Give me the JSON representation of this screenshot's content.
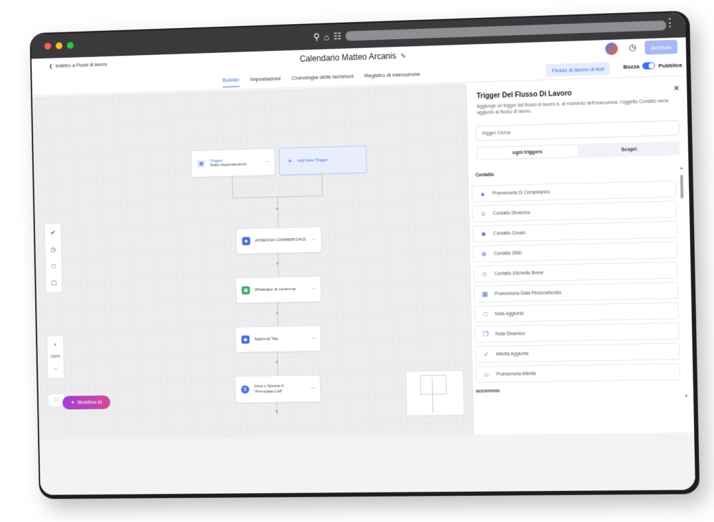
{
  "browser": {
    "url_placeholder": ""
  },
  "header": {
    "back_label": "Indietro a Flussi di lavoro",
    "title": "Calendario Matteo Arcanis",
    "archive_label": "Archivia"
  },
  "tabs": [
    {
      "label": "Builder",
      "active": true
    },
    {
      "label": "Impostazioni",
      "active": false
    },
    {
      "label": "Cronologia delle iscrizioni",
      "active": false
    },
    {
      "label": "Registro di esecuzione",
      "active": false
    }
  ],
  "actions": {
    "test_label": "Flusso di lavoro di test",
    "draft_label": "Bozza",
    "publish_label": "Pubblica"
  },
  "canvas": {
    "trigger_title": "Trigger",
    "trigger_subtitle": "Stato Appuntamento",
    "add_trigger_label": "Add New Trigger",
    "steps": [
      {
        "label": "ASSEGNA COMMERCIALE",
        "icon": "user-assign-icon",
        "color": "#4f6fdc"
      },
      {
        "label": "Whatsapp di conferma",
        "icon": "chat-icon",
        "color": "#3ea86b"
      },
      {
        "label": "Aggiungi Tag",
        "icon": "tag-icon",
        "color": "#4f6fdc"
      },
      {
        "label": "Crea o Sposta in \"Prenotata Call\"",
        "icon": "dollar-icon",
        "color": "#4f6fdc"
      }
    ],
    "zoom_level": "100%",
    "workflow_ai_label": "Workflow AI"
  },
  "panel": {
    "title": "Trigger Del Flusso Di Lavoro",
    "description": "Aggiunge un trigger del flusso di lavoro e, al momento dell'esecuzione, l'oggetto Contatto viene aggiunto al flusso di lavoro.",
    "search_placeholder": "trigger Cerca",
    "segments": [
      "ogni triggers",
      "Scopri"
    ],
    "section_contact": "Contatto",
    "section_next": "occorrenze",
    "items": [
      {
        "label": "Promemoria Di Compleanno",
        "icon": "cake-icon"
      },
      {
        "label": "Contatto Dinamico",
        "icon": "users-icon"
      },
      {
        "label": "Contatto Creato",
        "icon": "user-plus-icon"
      },
      {
        "label": "Contatto DND",
        "icon": "dnd-icon"
      },
      {
        "label": "Contatto Etichetta Breve",
        "icon": "tag-icon"
      },
      {
        "label": "Promemoria Data Personalizzato",
        "icon": "calendar-icon"
      },
      {
        "label": "Nota Aggiunta",
        "icon": "note-icon"
      },
      {
        "label": "Nota Dinamico",
        "icon": "notes-icon"
      },
      {
        "label": "Attività Aggiunta",
        "icon": "check-icon"
      },
      {
        "label": "Promemoria Attività",
        "icon": "bell-icon"
      }
    ]
  }
}
